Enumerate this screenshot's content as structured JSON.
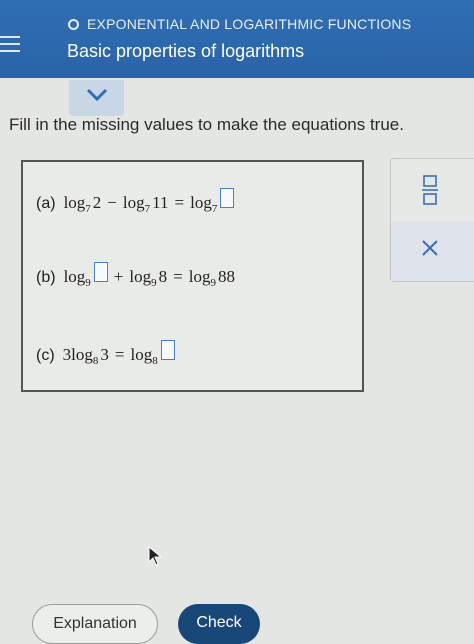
{
  "header": {
    "topic": "EXPONENTIAL AND LOGARITHMIC FUNCTIONS",
    "title": "Basic properties of logarithms"
  },
  "instructions": "Fill in the missing values to make the equations true.",
  "problems": {
    "a": {
      "label": "(a)",
      "log": "log",
      "b1": "7",
      "arg1": "2",
      "op": "−",
      "b2": "7",
      "arg2": "11",
      "eq": "=",
      "b3": "7"
    },
    "b": {
      "label": "(b)",
      "log": "log",
      "b1": "9",
      "op": "+",
      "b2": "9",
      "arg2": "8",
      "eq": "=",
      "b3": "9",
      "arg3": "88"
    },
    "c": {
      "label": "(c)",
      "coef": "3",
      "log": "log",
      "b1": "8",
      "arg1": "3",
      "eq": "=",
      "b2": "8"
    }
  },
  "buttons": {
    "explanation": "Explanation",
    "check": "Check"
  },
  "icons": {
    "menu": "hamburger-icon",
    "topic": "circle-icon",
    "collapse": "chevron-down-icon",
    "fraction": "fraction-template-icon",
    "close": "close-icon",
    "cursor": "mouse-pointer-icon"
  },
  "colors": {
    "header": "#2f6eb4",
    "check_button": "#184878",
    "answer_box_border": "#4a7fd0"
  }
}
